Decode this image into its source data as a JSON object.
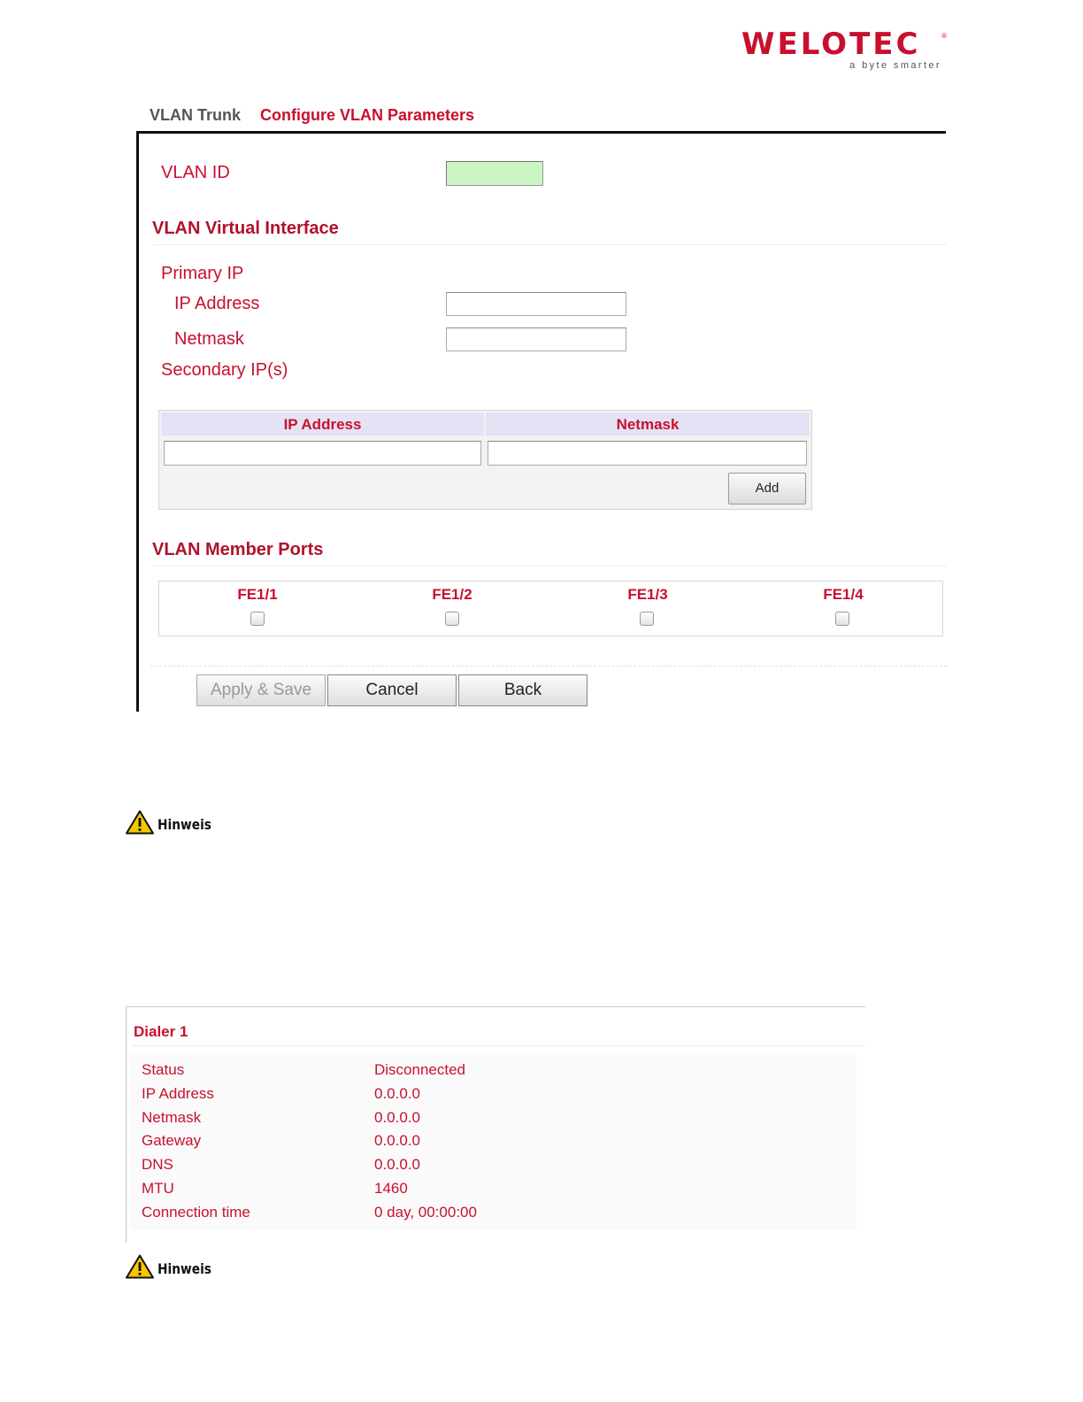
{
  "brand": {
    "name": "WELOTEC",
    "tagline": "a byte smarter",
    "reg": "®"
  },
  "tabs": [
    {
      "label": "VLAN Trunk"
    },
    {
      "label": "Configure VLAN Parameters"
    }
  ],
  "form": {
    "vlan_id_label": "VLAN ID",
    "vlan_id_value": "",
    "virtual_interface_title": "VLAN Virtual Interface",
    "primary_ip_label": "Primary IP",
    "ip_address_label": "IP Address",
    "ip_address_value": "",
    "netmask_label": "Netmask",
    "netmask_value": "",
    "secondary_ips_label": "Secondary IP(s)",
    "secondary_table": {
      "headers": [
        "IP Address",
        "Netmask"
      ],
      "ip_value": "",
      "netmask_value": "",
      "add_label": "Add"
    },
    "member_ports_title": "VLAN Member Ports",
    "ports": [
      {
        "label": "FE1/1",
        "checked": false
      },
      {
        "label": "FE1/2",
        "checked": false
      },
      {
        "label": "FE1/3",
        "checked": false
      },
      {
        "label": "FE1/4",
        "checked": false
      }
    ],
    "buttons": {
      "apply": "Apply & Save",
      "cancel": "Cancel",
      "back": "Back"
    }
  },
  "notes": [
    {
      "label": "Hinweis"
    },
    {
      "label": "Hinweis"
    }
  ],
  "dialer": {
    "title": "Dialer 1",
    "rows": [
      {
        "label": "Status",
        "value": "Disconnected"
      },
      {
        "label": "IP Address",
        "value": "0.0.0.0"
      },
      {
        "label": "Netmask",
        "value": "0.0.0.0"
      },
      {
        "label": "Gateway",
        "value": "0.0.0.0"
      },
      {
        "label": "DNS",
        "value": "0.0.0.0"
      },
      {
        "label": "MTU",
        "value": "1460"
      },
      {
        "label": "Connection time",
        "value": "0 day, 00:00:00"
      }
    ]
  },
  "colors": {
    "accent": "#c8102e",
    "vlan_id_bg": "#ccf5c4",
    "table_header_bg": "#e4e2f4"
  },
  "icons": {
    "warning": "warning-triangle-icon"
  }
}
